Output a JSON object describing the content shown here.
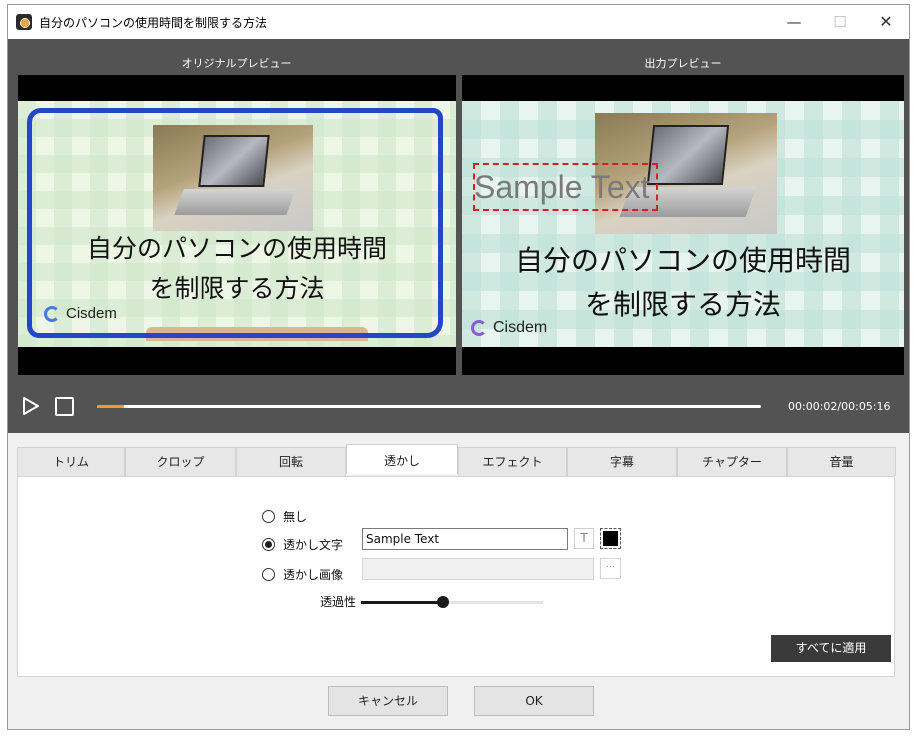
{
  "window": {
    "title": "自分のパソコンの使用時間を制限する方法",
    "minimize": "—",
    "maximize": "☐",
    "close": "✕"
  },
  "preview": {
    "original_label": "オリジナルプレビュー",
    "output_label": "出力プレビュー",
    "video_text_line1": "自分のパソコンの使用時間",
    "video_text_line2": "を制限する方法",
    "logo_text": "Cisdem",
    "watermark_text": "Sample Text"
  },
  "player": {
    "time": "00:00:02/00:05:16",
    "progress_fraction": 0.006
  },
  "tabs": [
    {
      "label": "トリム",
      "active": false
    },
    {
      "label": "クロップ",
      "active": false
    },
    {
      "label": "回転",
      "active": false
    },
    {
      "label": "透かし",
      "active": true
    },
    {
      "label": "エフェクト",
      "active": false
    },
    {
      "label": "字幕",
      "active": false
    },
    {
      "label": "チャプター",
      "active": false
    },
    {
      "label": "音量",
      "active": false
    }
  ],
  "watermark": {
    "none_label": "無し",
    "text_label": "透かし文字",
    "image_label": "透かし画像",
    "selected": "text",
    "text_value": "Sample Text",
    "font_button": "T",
    "color": "#000000",
    "browse_button": "···",
    "opacity_label": "透過性",
    "opacity_fraction": 0.45,
    "apply_all": "すべてに適用"
  },
  "footer": {
    "cancel": "キャンセル",
    "ok": "OK"
  }
}
